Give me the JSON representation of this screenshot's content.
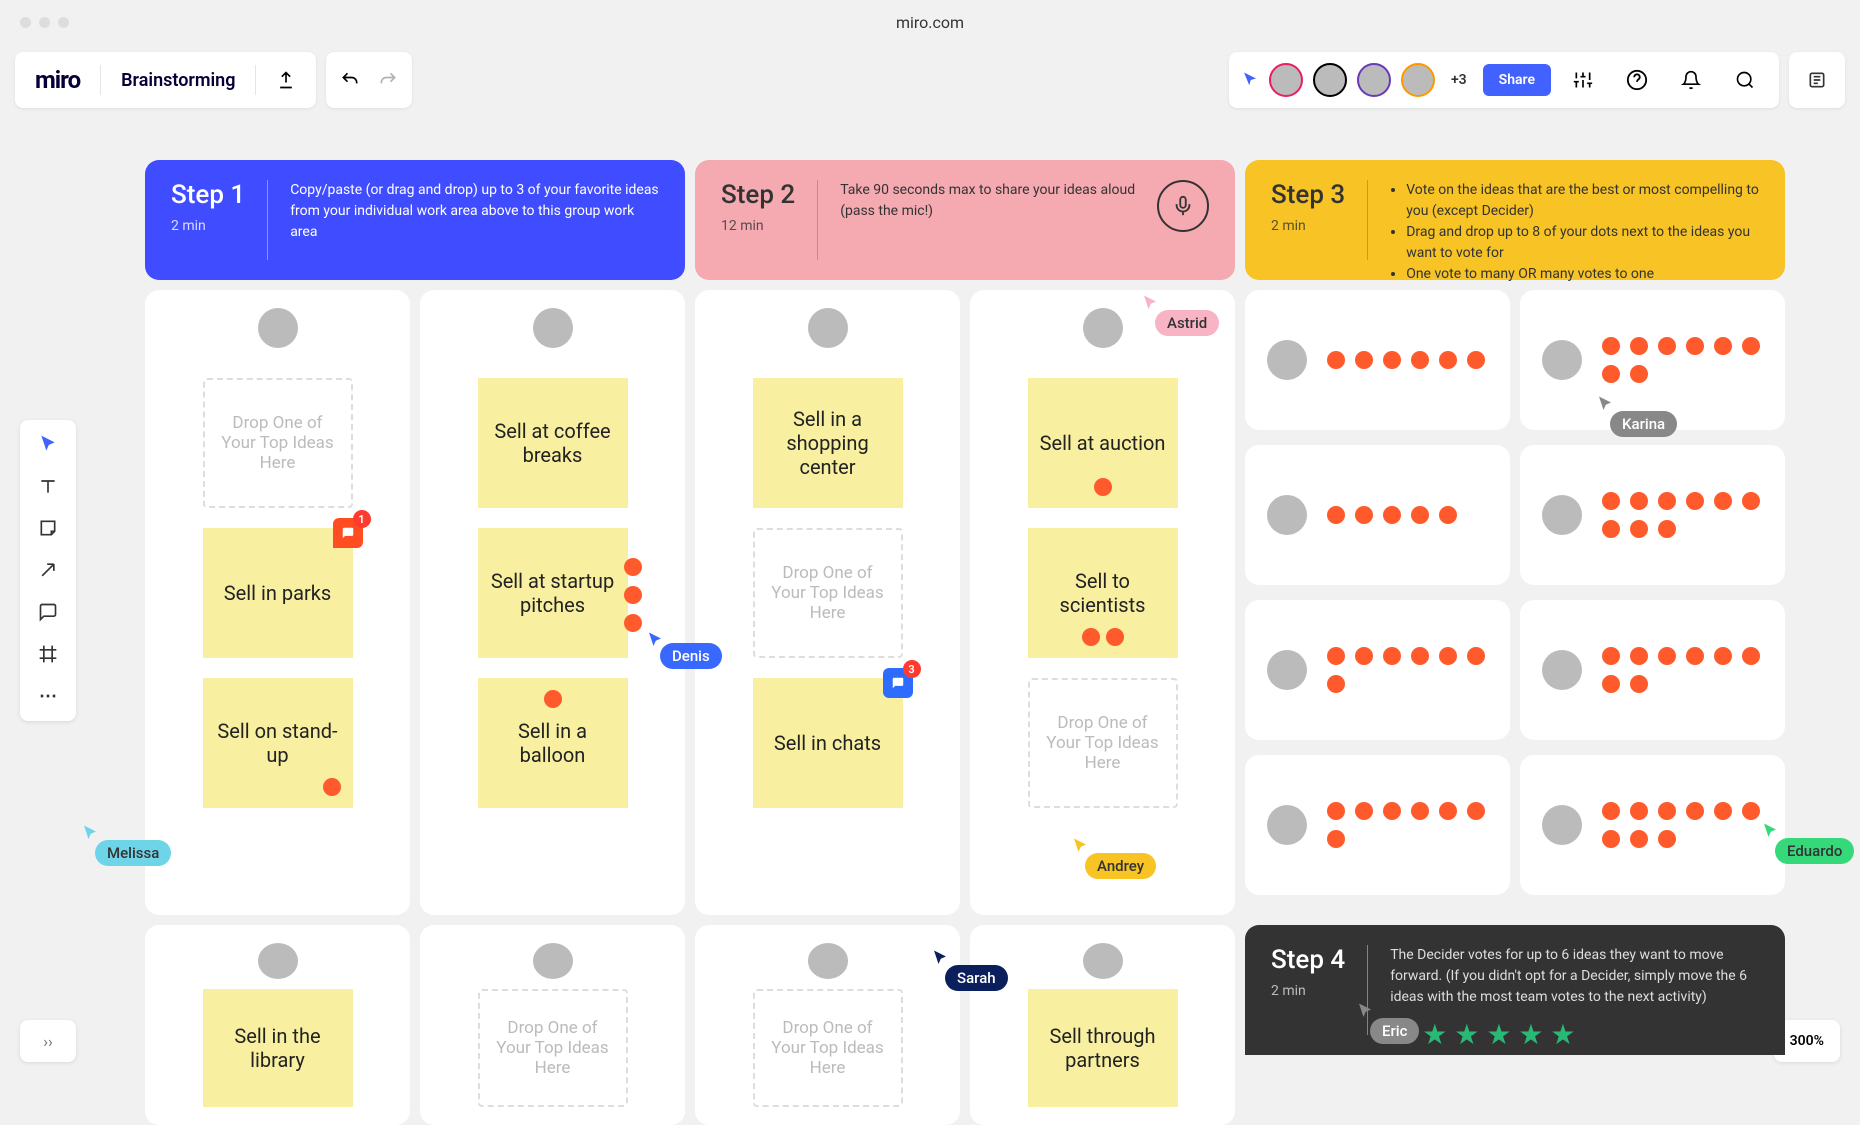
{
  "browser": {
    "url": "miro.com"
  },
  "header": {
    "logo": "miro",
    "board_name": "Brainstorming",
    "avatars_more": "+3",
    "share": "Share"
  },
  "footer": {
    "zoom": "300%"
  },
  "steps": {
    "s1": {
      "title": "Step 1",
      "time": "2 min",
      "desc": "Copy/paste (or drag and drop) up to 3 of your favorite ideas from your individual work area above to this group work area"
    },
    "s2": {
      "title": "Step 2",
      "time": "12 min",
      "desc": "Take 90 seconds max to share your ideas aloud (pass the mic!)"
    },
    "s3": {
      "title": "Step 3",
      "time": "2 min",
      "b1": "Vote on the ideas that are the best or most compelling to you (except Decider)",
      "b2": "Drag and drop up to 8 of your dots next to the ideas you want to vote for",
      "b3": "One vote to many OR many votes to one"
    },
    "s4": {
      "title": "Step 4",
      "time": "2 min",
      "desc": "The Decider votes for up to 6 ideas they want to move forward. (If you didn't opt for a Decider, simply move the 6 ideas with the most team votes to the next activity)"
    }
  },
  "placeholder": "Drop One of Your Top Ideas Here",
  "stickies": {
    "parks": "Sell in parks",
    "standup": "Sell on stand-up",
    "library": "Sell in the library",
    "coffee": "Sell at coffee breaks",
    "startup": "Sell at startup pitches",
    "balloon": "Sell in a balloon",
    "shopping": "Sell in a shopping center",
    "chats": "Sell in chats",
    "auction": "Sell at auction",
    "scientists": "Sell to scientists",
    "partners": "Sell through partners"
  },
  "comments": {
    "c1": "1",
    "c3": "3"
  },
  "cursors": {
    "melissa": "Melissa",
    "denis": "Denis",
    "astrid": "Astrid",
    "andrey": "Andrey",
    "sarah": "Sarah",
    "karina": "Karina",
    "eduardo": "Eduardo",
    "eric": "Eric"
  },
  "votes": {
    "r1a": 6,
    "r1b": 8,
    "r2a": 5,
    "r2b": 9,
    "r3a": 7,
    "r3b": 8,
    "r4a": 7,
    "r4b": 9
  }
}
